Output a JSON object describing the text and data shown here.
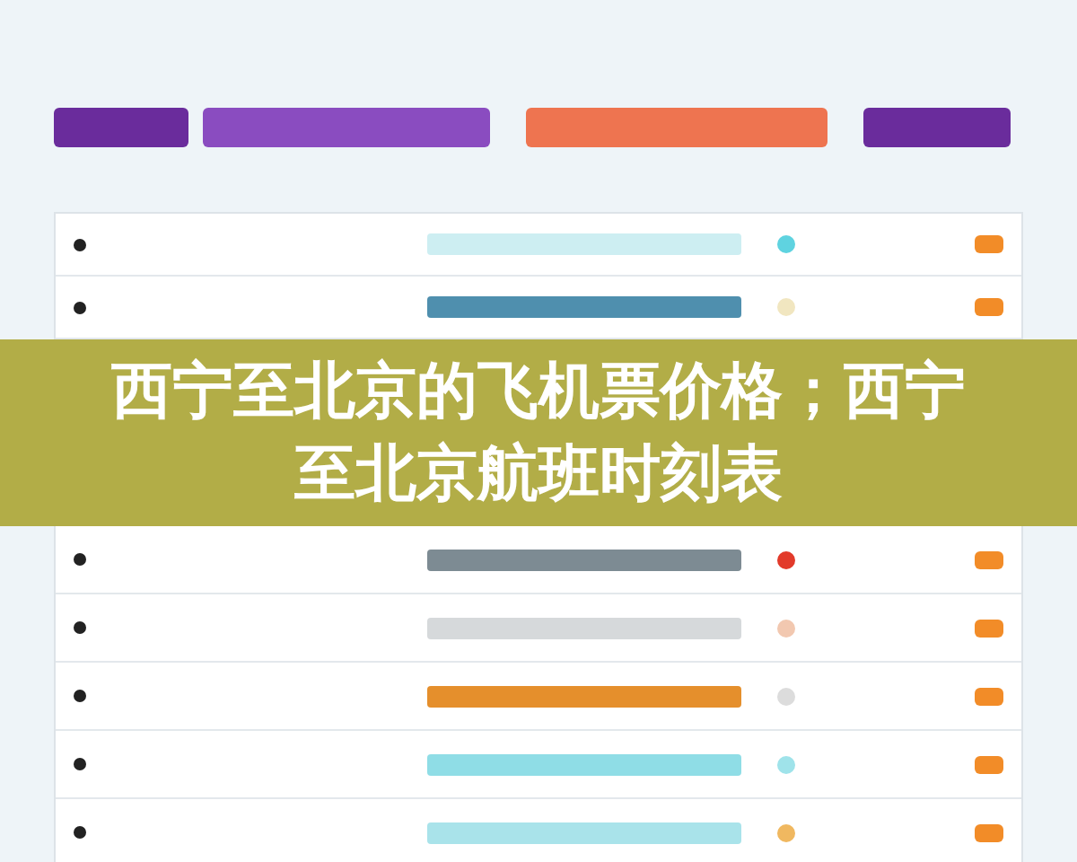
{
  "summary_bar": {
    "segments": [
      {
        "color": "#6a2c9c"
      },
      {
        "color": "#8a4cc0"
      },
      {
        "color": "#ee7450"
      },
      {
        "color": "#6a2c9c"
      }
    ]
  },
  "table": {
    "rows_top": [
      {
        "color": "#cdeef2"
      },
      {
        "color": "#4f8fae"
      }
    ],
    "status_dots_top": [
      {
        "color": "#5fd3e0"
      },
      {
        "color": "#f1e6c0"
      }
    ],
    "rows_bottom": [
      {
        "color": "#7d8b93"
      },
      {
        "color": "#d6d9db"
      },
      {
        "color": "#e58f2c"
      },
      {
        "color": "#8fdde6"
      },
      {
        "color": "#a9e3ea"
      }
    ],
    "status_dots_bottom": [
      {
        "color": "#e23a2a"
      },
      {
        "color": "#f2c8b0"
      },
      {
        "color": "#dcdcdc"
      },
      {
        "color": "#9fe3ea"
      },
      {
        "color": "#f0b860"
      }
    ]
  },
  "banner": {
    "title": "西宁至北京的飞机票价格；西宁至北京航班时刻表"
  }
}
